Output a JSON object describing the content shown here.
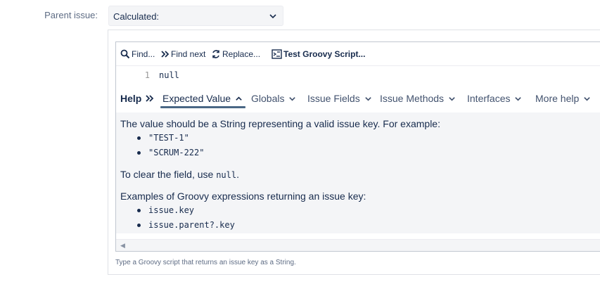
{
  "field": {
    "label": "Parent issue:",
    "select_value": "Calculated:"
  },
  "toolbar": {
    "find": "Find...",
    "find_next": "Find next",
    "replace": "Replace...",
    "test": "Test Groovy Script..."
  },
  "editor": {
    "line_number": "1",
    "code": "null"
  },
  "help_tabs": {
    "help": "Help",
    "tabs": [
      "Expected Value",
      "Globals",
      "Issue Fields",
      "Issue Methods",
      "Interfaces",
      "More help"
    ]
  },
  "help_content": {
    "intro": "The value should be a String representing a valid issue key. For example:",
    "examples": [
      "\"TEST-1\"",
      "\"SCRUM-222\""
    ],
    "clear_prefix": "To clear the field, use ",
    "clear_code": "null",
    "clear_suffix": ".",
    "groovy_intro": "Examples of Groovy expressions returning an issue key:",
    "groovy_examples": [
      "issue.key",
      "issue.parent?.key"
    ]
  },
  "hint": "Type a Groovy script that returns an issue key as a String."
}
